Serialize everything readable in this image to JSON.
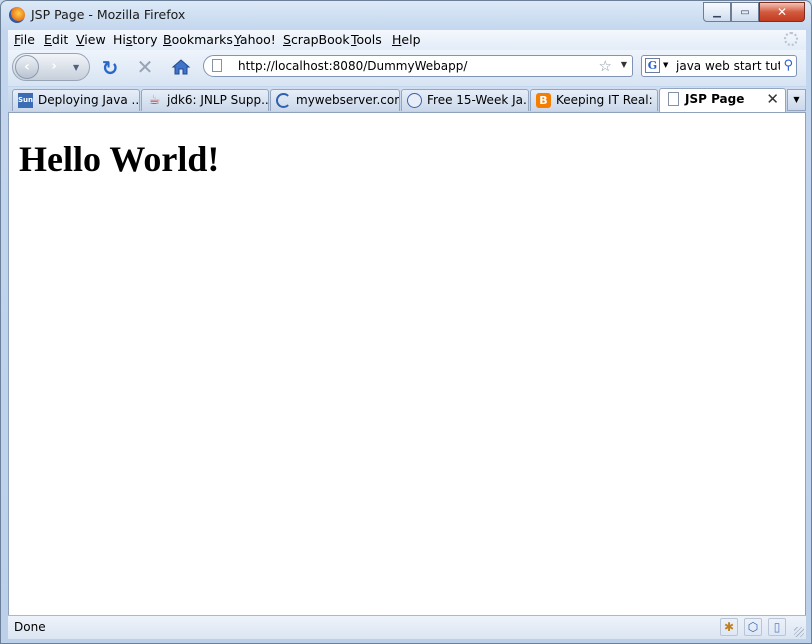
{
  "window": {
    "title": "JSP Page - Mozilla Firefox"
  },
  "menu": [
    {
      "label": "File",
      "key": "F",
      "rest": "ile"
    },
    {
      "label": "Edit",
      "key": "E",
      "rest": "dit"
    },
    {
      "label": "View",
      "key": "V",
      "rest": "iew"
    },
    {
      "label": "History",
      "pre": "Hi",
      "key": "s",
      "rest": "tory"
    },
    {
      "label": "Bookmarks",
      "key": "B",
      "rest": "ookmarks"
    },
    {
      "label": "Yahoo!",
      "key": "Y",
      "rest": "ahoo!"
    },
    {
      "label": "ScrapBook",
      "key": "S",
      "rest": "crapBook"
    },
    {
      "label": "Tools",
      "key": "T",
      "rest": "ools"
    },
    {
      "label": "Help",
      "key": "H",
      "rest": "elp"
    }
  ],
  "navbar": {
    "url": "http://localhost:8080/DummyWebapp/",
    "search_query": "java web start tutorial",
    "search_engine": "G"
  },
  "tabs": [
    {
      "label": "Deploying Java ...",
      "icon": "sun-icon"
    },
    {
      "label": "jdk6: JNLP Supp...",
      "icon": "java-icon"
    },
    {
      "label": "mywebserver.com",
      "icon": "loading-icon"
    },
    {
      "label": "Free 15-Week Ja...",
      "icon": "building-icon"
    },
    {
      "label": "Keeping IT Real: ...",
      "icon": "blogger-icon"
    },
    {
      "label": "JSP Page",
      "icon": "page-icon",
      "active": true
    }
  ],
  "page": {
    "heading": "Hello World!"
  },
  "status": {
    "text": "Done"
  },
  "colors": {
    "accent": "#2a68c8",
    "close": "#c23b20",
    "blogger": "#f57d00"
  }
}
